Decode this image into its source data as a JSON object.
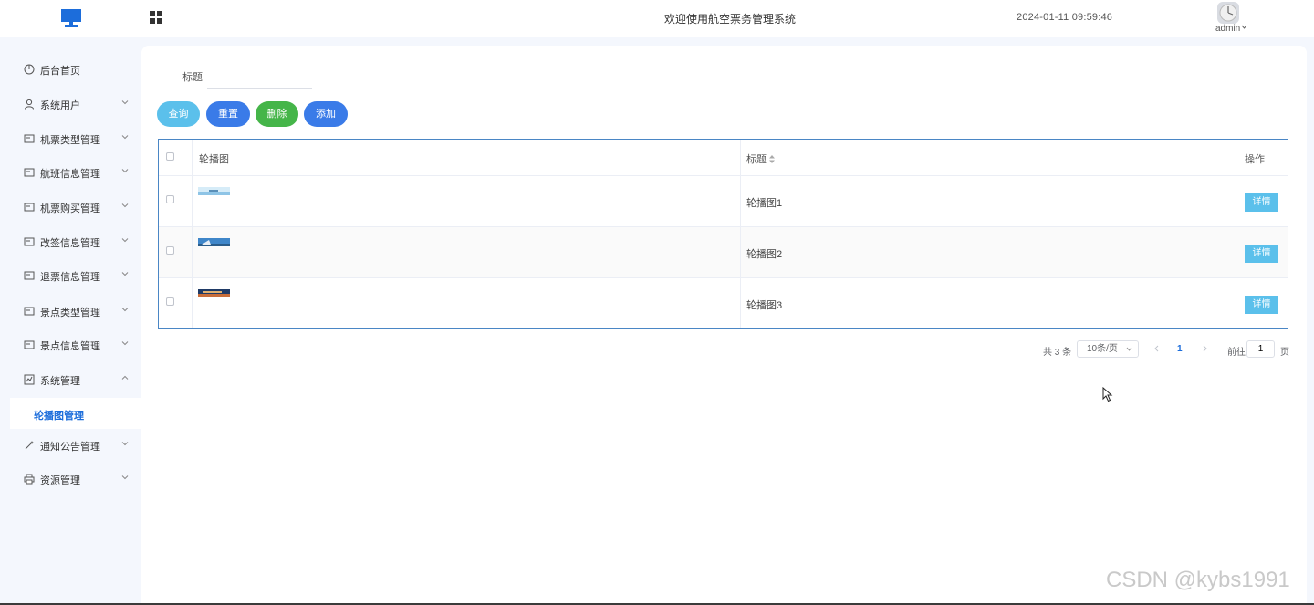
{
  "header": {
    "welcome_text": "欢迎使用航空票务管理系统",
    "datetime": "2024-01-11 09:59:46",
    "username": "admin",
    "accent_color": "#1c6ddb"
  },
  "sidebar": {
    "items": [
      {
        "label": "后台首页",
        "icon": "power-icon"
      },
      {
        "label": "系统用户",
        "icon": "user-icon"
      },
      {
        "label": "机票类型管理",
        "icon": "card-icon"
      },
      {
        "label": "航班信息管理",
        "icon": "card-icon"
      },
      {
        "label": "机票购买管理",
        "icon": "card-icon"
      },
      {
        "label": "改签信息管理",
        "icon": "card-icon"
      },
      {
        "label": "退票信息管理",
        "icon": "card-icon"
      },
      {
        "label": "景点类型管理",
        "icon": "card-icon"
      },
      {
        "label": "景点信息管理",
        "icon": "card-icon"
      },
      {
        "label": "系统管理",
        "icon": "chart-icon"
      },
      {
        "label": "通知公告管理",
        "icon": "magic-icon"
      },
      {
        "label": "资源管理",
        "icon": "printer-icon"
      }
    ],
    "active_sub_item": "轮播图管理"
  },
  "search": {
    "label": "标题",
    "value": ""
  },
  "actions": {
    "query": "查询",
    "reset": "重置",
    "delete": "删除",
    "add": "添加"
  },
  "table": {
    "columns": {
      "image": "轮播图",
      "title": "标题",
      "operation": "操作"
    },
    "rows": [
      {
        "title": "轮播图1",
        "detail": "详情"
      },
      {
        "title": "轮播图2",
        "detail": "详情"
      },
      {
        "title": "轮播图3",
        "detail": "详情"
      }
    ]
  },
  "pagination": {
    "total": "共 3 条",
    "page_size": "10条/页",
    "current_page": "1",
    "goto_prefix": "前往",
    "goto_value": "1",
    "goto_suffix": "页"
  },
  "watermark": "CSDN @kybs1991"
}
